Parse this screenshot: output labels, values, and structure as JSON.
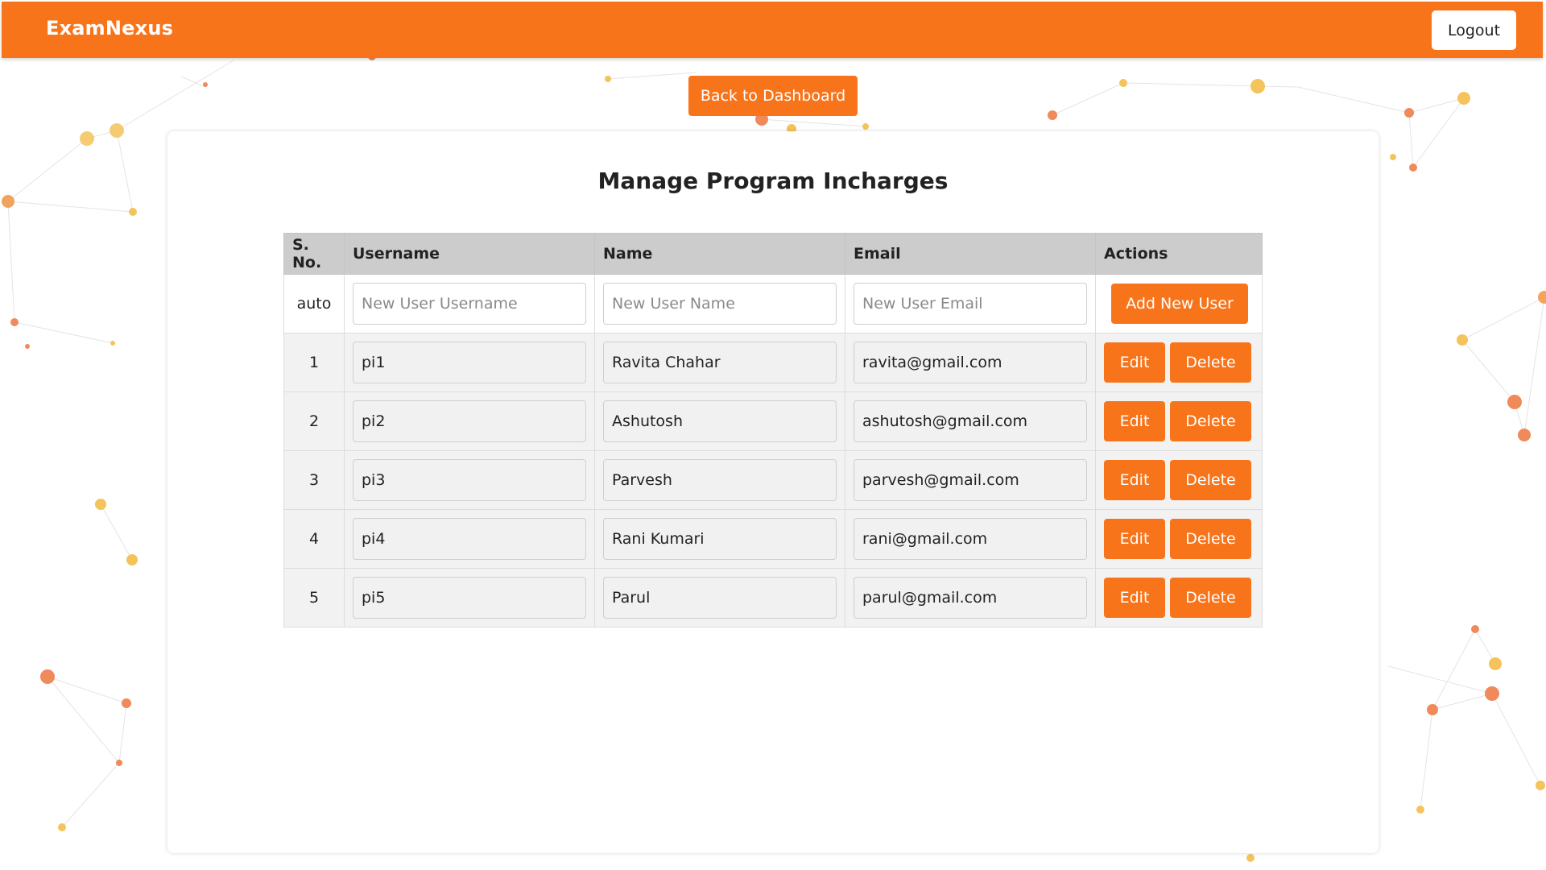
{
  "app": {
    "brand": "ExamNexus",
    "logout_label": "Logout",
    "back_label": "Back to Dashboard"
  },
  "colors": {
    "accent": "#f8741b",
    "header_bg": "#cccccc"
  },
  "page": {
    "title": "Manage Program Incharges"
  },
  "table": {
    "headers": {
      "sno": "S. No.",
      "username": "Username",
      "name": "Name",
      "email": "Email",
      "actions": "Actions"
    },
    "new_row": {
      "sno": "auto",
      "username_placeholder": "New User Username",
      "name_placeholder": "New User Name",
      "email_placeholder": "New User Email",
      "add_label": "Add New User"
    },
    "edit_label": "Edit",
    "delete_label": "Delete",
    "rows": [
      {
        "sno": "1",
        "username": "pi1",
        "name": "Ravita Chahar",
        "email": "ravita@gmail.com"
      },
      {
        "sno": "2",
        "username": "pi2",
        "name": "Ashutosh",
        "email": "ashutosh@gmail.com"
      },
      {
        "sno": "3",
        "username": "pi3",
        "name": "Parvesh",
        "email": "parvesh@gmail.com"
      },
      {
        "sno": "4",
        "username": "pi4",
        "name": "Rani Kumari",
        "email": "rani@gmail.com"
      },
      {
        "sno": "5",
        "username": "pi5",
        "name": "Parul",
        "email": "parul@gmail.com"
      }
    ]
  }
}
